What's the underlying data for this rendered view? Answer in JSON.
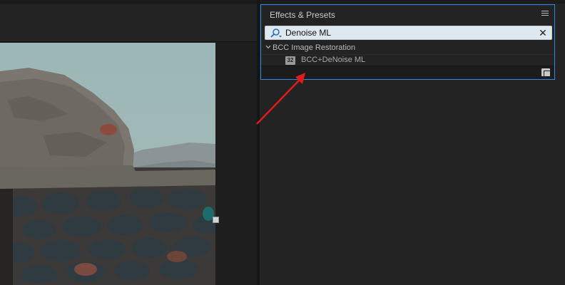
{
  "effects_panel": {
    "title": "Effects & Presets",
    "search": {
      "value": "Denoise ML",
      "placeholder": ""
    },
    "tree": {
      "folder_label": "BCC Image Restoration",
      "item_label": "BCC+DeNoise ML",
      "item_icon_text": "32"
    }
  },
  "colors": {
    "accent_border": "#2d8ceb",
    "annotation_arrow": "#e01b1b",
    "search_bg": "#dfe8ef"
  }
}
